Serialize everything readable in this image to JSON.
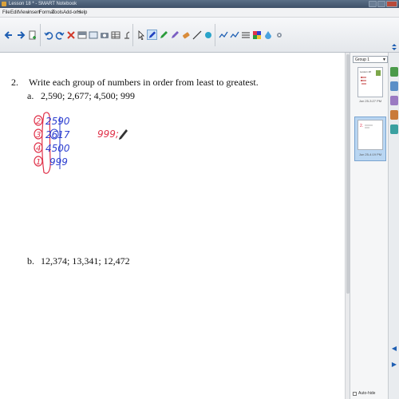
{
  "window": {
    "title": "Lesson 18 * - SMART Notebook"
  },
  "menu": [
    "File",
    "Edit",
    "View",
    "Insert",
    "Format",
    "Tools",
    "Add-ons",
    "Help"
  ],
  "toolbar": {
    "icons": [
      "previous-page-icon",
      "next-page-icon",
      "add-page-icon",
      "undo-icon",
      "redo-icon",
      "delete-icon",
      "screen-shade-icon",
      "full-screen-icon",
      "camera-icon",
      "table-icon",
      "document-camera-icon",
      "select-icon",
      "pen-icon",
      "creative-pen-icon",
      "eraser-icon",
      "line-icon",
      "shape-icon",
      "fill-icon",
      "text-icon",
      "properties-icon",
      "line-style-icon",
      "color-palette-icon",
      "transparency-icon",
      "toolbar-settings-icon"
    ]
  },
  "sidebar": {
    "group_label": "Group 1",
    "thumbnails": [
      {
        "caption": "Jun 25-3:27 PM"
      },
      {
        "caption": "Jun 25-4:19 PM"
      }
    ],
    "autohide_label": "Auto-hide"
  },
  "content": {
    "question_number": "2.",
    "question_text": "Write each group of numbers in order from least to greatest.",
    "part_a_label": "a.",
    "part_a_numbers": "2,590; 2,677; 4,500; 999",
    "part_b_label": "b.",
    "part_b_numbers": "12,374; 13,341; 12,472"
  },
  "ink": {
    "blue_numbers": [
      "2590",
      "2617",
      "4500",
      "999"
    ],
    "red_order": [
      "2",
      "3",
      "4",
      "1"
    ],
    "red_answer": "999;"
  },
  "colors": {
    "ink_blue": "#2d3fd0",
    "ink_red": "#e0324a",
    "title_bar": "#4b5d74",
    "toolbar_bg": "#eceef1"
  }
}
